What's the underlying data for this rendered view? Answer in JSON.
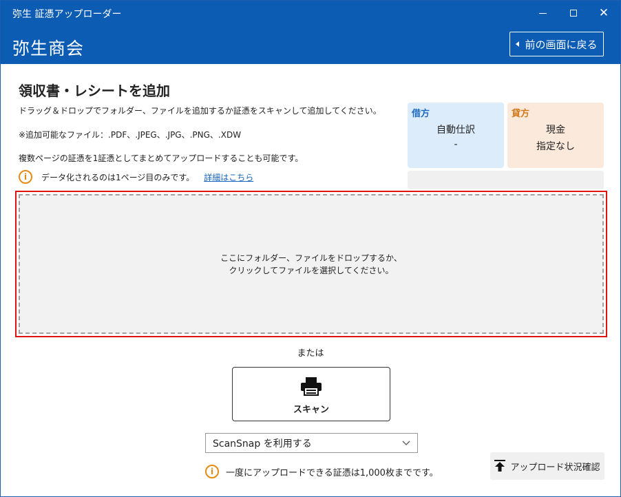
{
  "window": {
    "title": "弥生 証憑アップローダー",
    "minimize_icon": "minimize-icon",
    "maximize_icon": "maximize-icon",
    "close_icon": "close-icon",
    "close_glyph": "✕"
  },
  "header": {
    "company": "弥生商会",
    "back_label": "前の画面に戻る",
    "back_icon": "caret-left-icon"
  },
  "main": {
    "title": "領収書・レシートを追加",
    "description": "ドラッグ＆ドロップでフォルダー、ファイルを追加するか証憑をスキャンして追加してください。",
    "file_types": "※追加可能なファイル：.PDF、.JPEG、.JPG、.PNG、.XDW",
    "multi_page": "複数ページの証憑を1証憑としてまとめてアップロードすることも可能です。",
    "notice": "データ化されるのは1ページ目のみです。",
    "notice_link": "詳細はこちら",
    "info_glyph": "i"
  },
  "debit": {
    "label": "借方",
    "value1": "自動仕訳",
    "value2": "-"
  },
  "credit": {
    "label": "貸方",
    "value1": "現金",
    "value2": "指定なし"
  },
  "dropzone": {
    "line1": "ここにフォルダー、ファイルをドロップするか、",
    "line2": "クリックしてファイルを選択してください。"
  },
  "or_text": "または",
  "scan": {
    "label": "スキャン",
    "icon": "printer-icon"
  },
  "scanner_select": {
    "value": "ScanSnap を利用する",
    "icon": "chevron-down-icon"
  },
  "limit_notice": "一度にアップロードできる証憑は1,000枚までです。",
  "status_button": {
    "label": "アップロード状況確認",
    "icon": "upload-icon"
  },
  "colors": {
    "header_blue": "#0c5cb4",
    "dropzone_border": "#e01313",
    "info_orange": "#e58a12",
    "debit_bg": "#dcecfb",
    "credit_bg": "#fbe9dc"
  }
}
